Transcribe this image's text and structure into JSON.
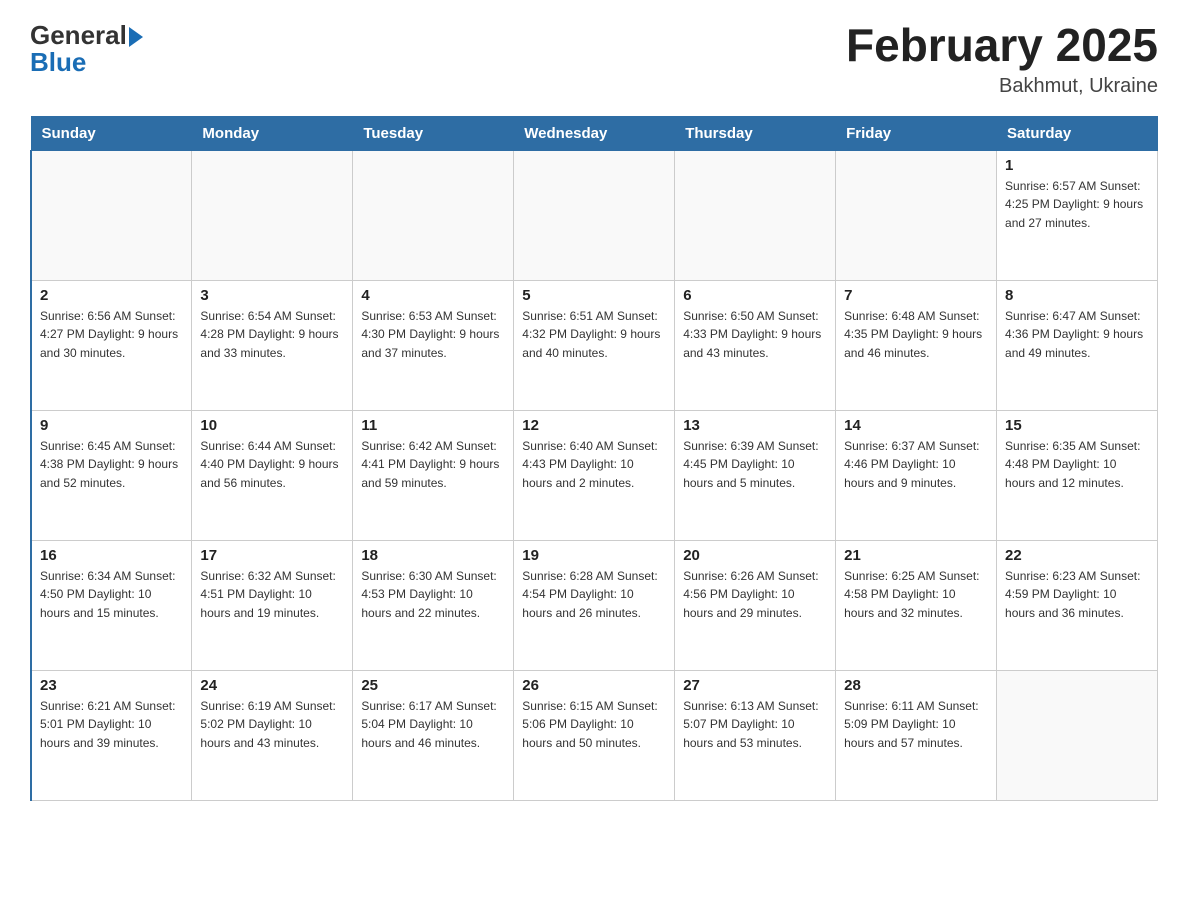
{
  "header": {
    "logo_general": "General",
    "logo_blue": "Blue",
    "month_year": "February 2025",
    "location": "Bakhmut, Ukraine"
  },
  "days_of_week": [
    "Sunday",
    "Monday",
    "Tuesday",
    "Wednesday",
    "Thursday",
    "Friday",
    "Saturday"
  ],
  "weeks": [
    [
      {
        "day": "",
        "info": ""
      },
      {
        "day": "",
        "info": ""
      },
      {
        "day": "",
        "info": ""
      },
      {
        "day": "",
        "info": ""
      },
      {
        "day": "",
        "info": ""
      },
      {
        "day": "",
        "info": ""
      },
      {
        "day": "1",
        "info": "Sunrise: 6:57 AM\nSunset: 4:25 PM\nDaylight: 9 hours and 27 minutes."
      }
    ],
    [
      {
        "day": "2",
        "info": "Sunrise: 6:56 AM\nSunset: 4:27 PM\nDaylight: 9 hours and 30 minutes."
      },
      {
        "day": "3",
        "info": "Sunrise: 6:54 AM\nSunset: 4:28 PM\nDaylight: 9 hours and 33 minutes."
      },
      {
        "day": "4",
        "info": "Sunrise: 6:53 AM\nSunset: 4:30 PM\nDaylight: 9 hours and 37 minutes."
      },
      {
        "day": "5",
        "info": "Sunrise: 6:51 AM\nSunset: 4:32 PM\nDaylight: 9 hours and 40 minutes."
      },
      {
        "day": "6",
        "info": "Sunrise: 6:50 AM\nSunset: 4:33 PM\nDaylight: 9 hours and 43 minutes."
      },
      {
        "day": "7",
        "info": "Sunrise: 6:48 AM\nSunset: 4:35 PM\nDaylight: 9 hours and 46 minutes."
      },
      {
        "day": "8",
        "info": "Sunrise: 6:47 AM\nSunset: 4:36 PM\nDaylight: 9 hours and 49 minutes."
      }
    ],
    [
      {
        "day": "9",
        "info": "Sunrise: 6:45 AM\nSunset: 4:38 PM\nDaylight: 9 hours and 52 minutes."
      },
      {
        "day": "10",
        "info": "Sunrise: 6:44 AM\nSunset: 4:40 PM\nDaylight: 9 hours and 56 minutes."
      },
      {
        "day": "11",
        "info": "Sunrise: 6:42 AM\nSunset: 4:41 PM\nDaylight: 9 hours and 59 minutes."
      },
      {
        "day": "12",
        "info": "Sunrise: 6:40 AM\nSunset: 4:43 PM\nDaylight: 10 hours and 2 minutes."
      },
      {
        "day": "13",
        "info": "Sunrise: 6:39 AM\nSunset: 4:45 PM\nDaylight: 10 hours and 5 minutes."
      },
      {
        "day": "14",
        "info": "Sunrise: 6:37 AM\nSunset: 4:46 PM\nDaylight: 10 hours and 9 minutes."
      },
      {
        "day": "15",
        "info": "Sunrise: 6:35 AM\nSunset: 4:48 PM\nDaylight: 10 hours and 12 minutes."
      }
    ],
    [
      {
        "day": "16",
        "info": "Sunrise: 6:34 AM\nSunset: 4:50 PM\nDaylight: 10 hours and 15 minutes."
      },
      {
        "day": "17",
        "info": "Sunrise: 6:32 AM\nSunset: 4:51 PM\nDaylight: 10 hours and 19 minutes."
      },
      {
        "day": "18",
        "info": "Sunrise: 6:30 AM\nSunset: 4:53 PM\nDaylight: 10 hours and 22 minutes."
      },
      {
        "day": "19",
        "info": "Sunrise: 6:28 AM\nSunset: 4:54 PM\nDaylight: 10 hours and 26 minutes."
      },
      {
        "day": "20",
        "info": "Sunrise: 6:26 AM\nSunset: 4:56 PM\nDaylight: 10 hours and 29 minutes."
      },
      {
        "day": "21",
        "info": "Sunrise: 6:25 AM\nSunset: 4:58 PM\nDaylight: 10 hours and 32 minutes."
      },
      {
        "day": "22",
        "info": "Sunrise: 6:23 AM\nSunset: 4:59 PM\nDaylight: 10 hours and 36 minutes."
      }
    ],
    [
      {
        "day": "23",
        "info": "Sunrise: 6:21 AM\nSunset: 5:01 PM\nDaylight: 10 hours and 39 minutes."
      },
      {
        "day": "24",
        "info": "Sunrise: 6:19 AM\nSunset: 5:02 PM\nDaylight: 10 hours and 43 minutes."
      },
      {
        "day": "25",
        "info": "Sunrise: 6:17 AM\nSunset: 5:04 PM\nDaylight: 10 hours and 46 minutes."
      },
      {
        "day": "26",
        "info": "Sunrise: 6:15 AM\nSunset: 5:06 PM\nDaylight: 10 hours and 50 minutes."
      },
      {
        "day": "27",
        "info": "Sunrise: 6:13 AM\nSunset: 5:07 PM\nDaylight: 10 hours and 53 minutes."
      },
      {
        "day": "28",
        "info": "Sunrise: 6:11 AM\nSunset: 5:09 PM\nDaylight: 10 hours and 57 minutes."
      },
      {
        "day": "",
        "info": ""
      }
    ]
  ]
}
